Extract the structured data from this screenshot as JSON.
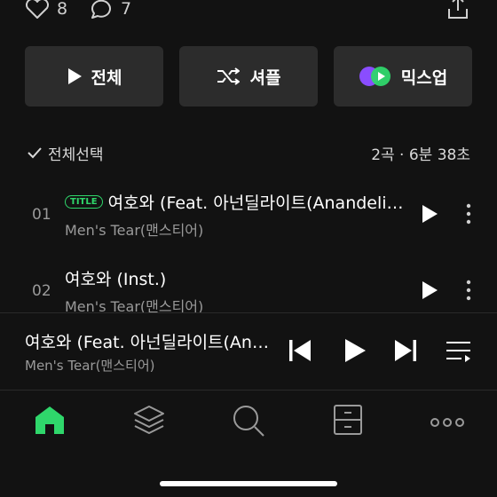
{
  "stats": {
    "likes": "8",
    "comments": "7"
  },
  "actions": {
    "play_all": "전체",
    "shuffle": "셔플",
    "mix_up": "믹스업"
  },
  "selection": {
    "select_all": "전체선택",
    "summary": "2곡 · 6분 38초"
  },
  "tracks": [
    {
      "number": "01",
      "badge": "TITLE",
      "title": "여호와 (Feat. 아넌딜라이트(Anandelight))",
      "artist": "Men's Tear(맨스티어)"
    },
    {
      "number": "02",
      "badge": "",
      "title": "여호와 (Inst.)",
      "artist": "Men's Tear(맨스티어)"
    }
  ],
  "now_playing": {
    "title": "여호와 (Feat. 아넌딜라이트(Anandelight))",
    "artist": "Men's Tear(맨스티어)"
  },
  "colors": {
    "accent": "#2fd76b",
    "background": "#121212",
    "button_bg": "#2c2c2c"
  },
  "icons": {
    "tabs": [
      "home-icon",
      "library-icon",
      "search-icon",
      "storage-icon",
      "more-icon"
    ]
  }
}
